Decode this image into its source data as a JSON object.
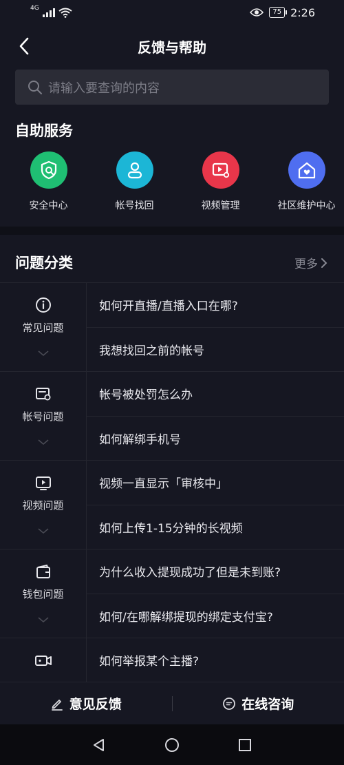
{
  "status_bar": {
    "network": "4G",
    "battery": "75",
    "time": "2:26"
  },
  "header": {
    "title": "反馈与帮助"
  },
  "search": {
    "placeholder": "请输入要查询的内容"
  },
  "self_service": {
    "title": "自助服务",
    "items": [
      {
        "label": "安全中心",
        "icon": "shield-icon",
        "color": "#1fbf73"
      },
      {
        "label": "帐号找回",
        "icon": "user-icon",
        "color": "#1cb6d6"
      },
      {
        "label": "视频管理",
        "icon": "video-settings-icon",
        "color": "#e8364a"
      },
      {
        "label": "社区维护中心",
        "icon": "home-heart-icon",
        "color": "#4f6ef0"
      }
    ]
  },
  "categories": {
    "title": "问题分类",
    "more": "更多",
    "items": [
      {
        "label": "常见问题",
        "icon": "info-icon"
      },
      {
        "label": "帐号问题",
        "icon": "account-card-icon"
      },
      {
        "label": "视频问题",
        "icon": "play-icon"
      },
      {
        "label": "钱包问题",
        "icon": "wallet-icon"
      },
      {
        "label": "",
        "icon": "live-camera-icon"
      }
    ],
    "questions": [
      "如何开直播/直播入口在哪?",
      "我想找回之前的帐号",
      "帐号被处罚怎么办",
      "如何解绑手机号",
      "视频一直显示「审核中」",
      "如何上传1-15分钟的长视频",
      "为什么收入提现成功了但是未到账?",
      "如何/在哪解绑提现的绑定支付宝?",
      "如何举报某个主播?"
    ]
  },
  "actions": {
    "feedback": "意见反馈",
    "consult": "在线咨询"
  },
  "colors": {
    "background": "#161722",
    "search_bg": "#2b2c36",
    "divider": "#0f1017"
  }
}
